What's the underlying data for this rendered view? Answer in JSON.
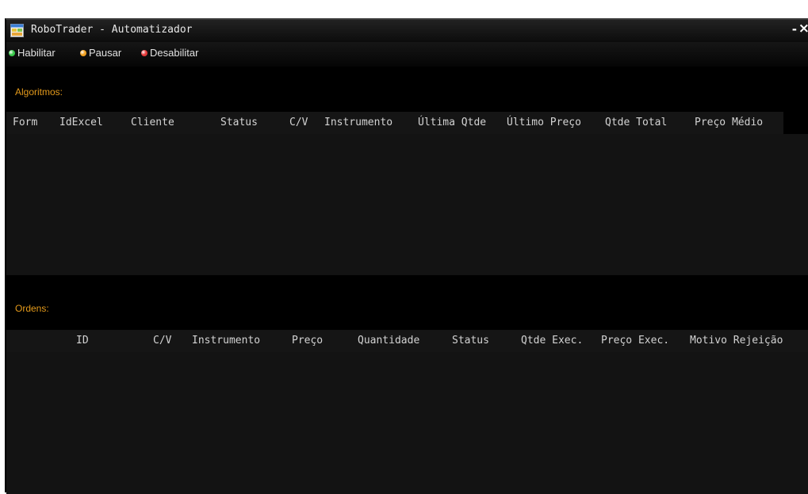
{
  "window": {
    "title": "RoboTrader - Automatizador",
    "minimize_glyph": "-",
    "close_glyph": "×"
  },
  "toolbar": {
    "enable": {
      "label": "Habilitar",
      "color": "#39c94a"
    },
    "pause": {
      "label": "Pausar",
      "color": "#f0a020"
    },
    "disable": {
      "label": "Desabilitar",
      "color": "#e53a3a"
    }
  },
  "algorithms": {
    "label": "Algoritmos:",
    "columns": [
      "Form",
      "IdExcel",
      "Cliente",
      "Status",
      "C/V",
      "Instrumento",
      "Última Qtde",
      "Último Preço",
      "Qtde Total",
      "Preço Médio"
    ]
  },
  "orders": {
    "label": "Ordens:",
    "columns": [
      "ID",
      "C/V",
      "Instrumento",
      "Preço",
      "Quantidade",
      "Status",
      "Qtde Exec.",
      "Preço Exec.",
      "Motivo Rejeição"
    ]
  },
  "colors": {
    "accent": "#e49a1b",
    "background": "#000000",
    "grid": "#131313"
  },
  "icons": {
    "app": "app-window-icon",
    "minimize": "minimize-icon",
    "close": "close-icon"
  }
}
